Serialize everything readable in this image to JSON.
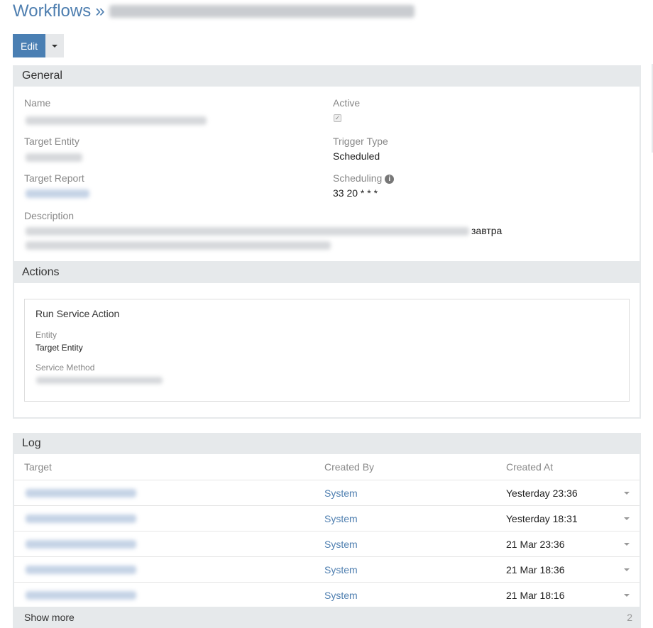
{
  "breadcrumb": {
    "root": "Workflows",
    "separator": "»"
  },
  "toolbar": {
    "edit_label": "Edit"
  },
  "general": {
    "header": "General",
    "name_label": "Name",
    "active_label": "Active",
    "active_checked": true,
    "target_entity_label": "Target Entity",
    "trigger_type_label": "Trigger Type",
    "trigger_type_value": "Scheduled",
    "target_report_label": "Target Report",
    "scheduling_label": "Scheduling",
    "scheduling_value": "33 20 * * *",
    "description_label": "Description",
    "description_visible_fragment": "завтра"
  },
  "actions": {
    "header": "Actions",
    "items": [
      {
        "title": "Run Service Action",
        "entity_label": "Entity",
        "entity_value": "Target Entity",
        "service_method_label": "Service Method"
      }
    ]
  },
  "log": {
    "header": "Log",
    "columns": [
      "Target",
      "Created By",
      "Created At"
    ],
    "rows": [
      {
        "created_by": "System",
        "created_at": "Yesterday 23:36"
      },
      {
        "created_by": "System",
        "created_at": "Yesterday 18:31"
      },
      {
        "created_by": "System",
        "created_at": "21 Mar 23:36"
      },
      {
        "created_by": "System",
        "created_at": "21 Mar 18:36"
      },
      {
        "created_by": "System",
        "created_at": "21 Mar 18:16"
      }
    ],
    "show_more_label": "Show more",
    "remaining_count": "2"
  }
}
